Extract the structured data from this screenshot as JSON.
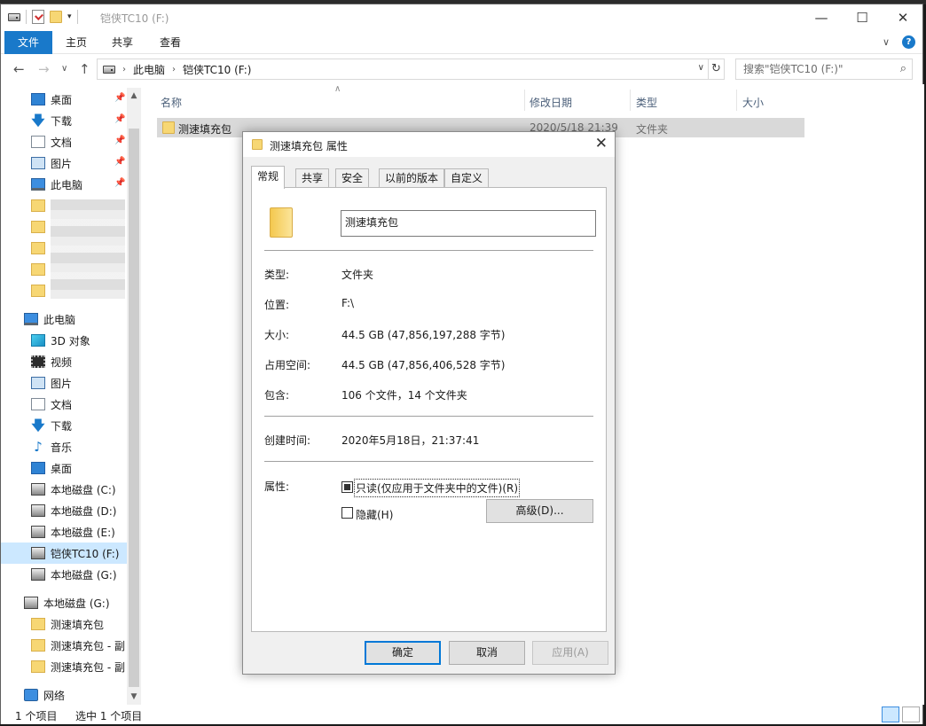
{
  "window": {
    "title": "铠侠TC10 (F:)",
    "controls": {
      "minimize": "—",
      "maximize": "☐",
      "close": "✕"
    }
  },
  "ribbon": {
    "tabs": [
      "文件",
      "主页",
      "共享",
      "查看"
    ],
    "accent": "#1979ca"
  },
  "address": {
    "crumbs": [
      "此电脑",
      "铠侠TC10 (F:)"
    ],
    "search_placeholder": "搜索\"铠侠TC10 (F:)\""
  },
  "sidebar": {
    "quick_access": [
      {
        "label": "桌面",
        "icon": "desktop-icon",
        "pinned": true
      },
      {
        "label": "下载",
        "icon": "download-icon",
        "pinned": true
      },
      {
        "label": "文档",
        "icon": "document-icon",
        "pinned": true
      },
      {
        "label": "图片",
        "icon": "pictures-icon",
        "pinned": true
      },
      {
        "label": "此电脑",
        "icon": "computer-icon",
        "pinned": true
      }
    ],
    "this_pc": {
      "label": "此电脑"
    },
    "pc_items": [
      {
        "label": "3D 对象",
        "icon": "3d-objects-icon"
      },
      {
        "label": "视频",
        "icon": "video-icon"
      },
      {
        "label": "图片",
        "icon": "pictures-icon"
      },
      {
        "label": "文档",
        "icon": "document-icon"
      },
      {
        "label": "下载",
        "icon": "download-icon"
      },
      {
        "label": "音乐",
        "icon": "music-icon"
      },
      {
        "label": "桌面",
        "icon": "desktop-icon"
      },
      {
        "label": "本地磁盘 (C:)",
        "icon": "drive-icon"
      },
      {
        "label": "本地磁盘 (D:)",
        "icon": "drive-icon"
      },
      {
        "label": "本地磁盘 (E:)",
        "icon": "drive-icon"
      },
      {
        "label": "铠侠TC10 (F:)",
        "icon": "drive-icon",
        "selected": true
      },
      {
        "label": "本地磁盘 (G:)",
        "icon": "drive-icon"
      }
    ],
    "drive_g": {
      "label": "本地磁盘 (G:)"
    },
    "g_items": [
      {
        "label": "测速填充包"
      },
      {
        "label": "测速填充包 - 副"
      },
      {
        "label": "测速填充包 - 副"
      }
    ],
    "network": {
      "label": "网络"
    }
  },
  "filelist": {
    "columns": [
      "名称",
      "修改日期",
      "类型",
      "大小"
    ],
    "rows": [
      {
        "name": "测速填充包",
        "modified": "2020/5/18 21:39",
        "type": "文件夹",
        "size": ""
      }
    ]
  },
  "status": {
    "count": "1 个项目",
    "selected": "选中 1 个项目"
  },
  "dialog": {
    "title": "测速填充包 属性",
    "tabs": [
      "常规",
      "共享",
      "安全",
      "以前的版本",
      "自定义"
    ],
    "active_tab": "常规",
    "name": "测速填充包",
    "fields": [
      {
        "label": "类型:",
        "value": "文件夹"
      },
      {
        "label": "位置:",
        "value": "F:\\"
      },
      {
        "label": "大小:",
        "value": "44.5 GB (47,856,197,288 字节)"
      },
      {
        "label": "占用空间:",
        "value": "44.5 GB (47,856,406,528 字节)"
      },
      {
        "label": "包含:",
        "value": "106 个文件，14 个文件夹"
      }
    ],
    "created_label": "创建时间:",
    "created_value": "2020年5月18日，21:37:41",
    "attributes_label": "属性:",
    "readonly_label": "只读(仅应用于文件夹中的文件)(R)",
    "hidden_label": "隐藏(H)",
    "advanced_label": "高级(D)...",
    "buttons": {
      "ok": "确定",
      "cancel": "取消",
      "apply": "应用(A)"
    }
  }
}
